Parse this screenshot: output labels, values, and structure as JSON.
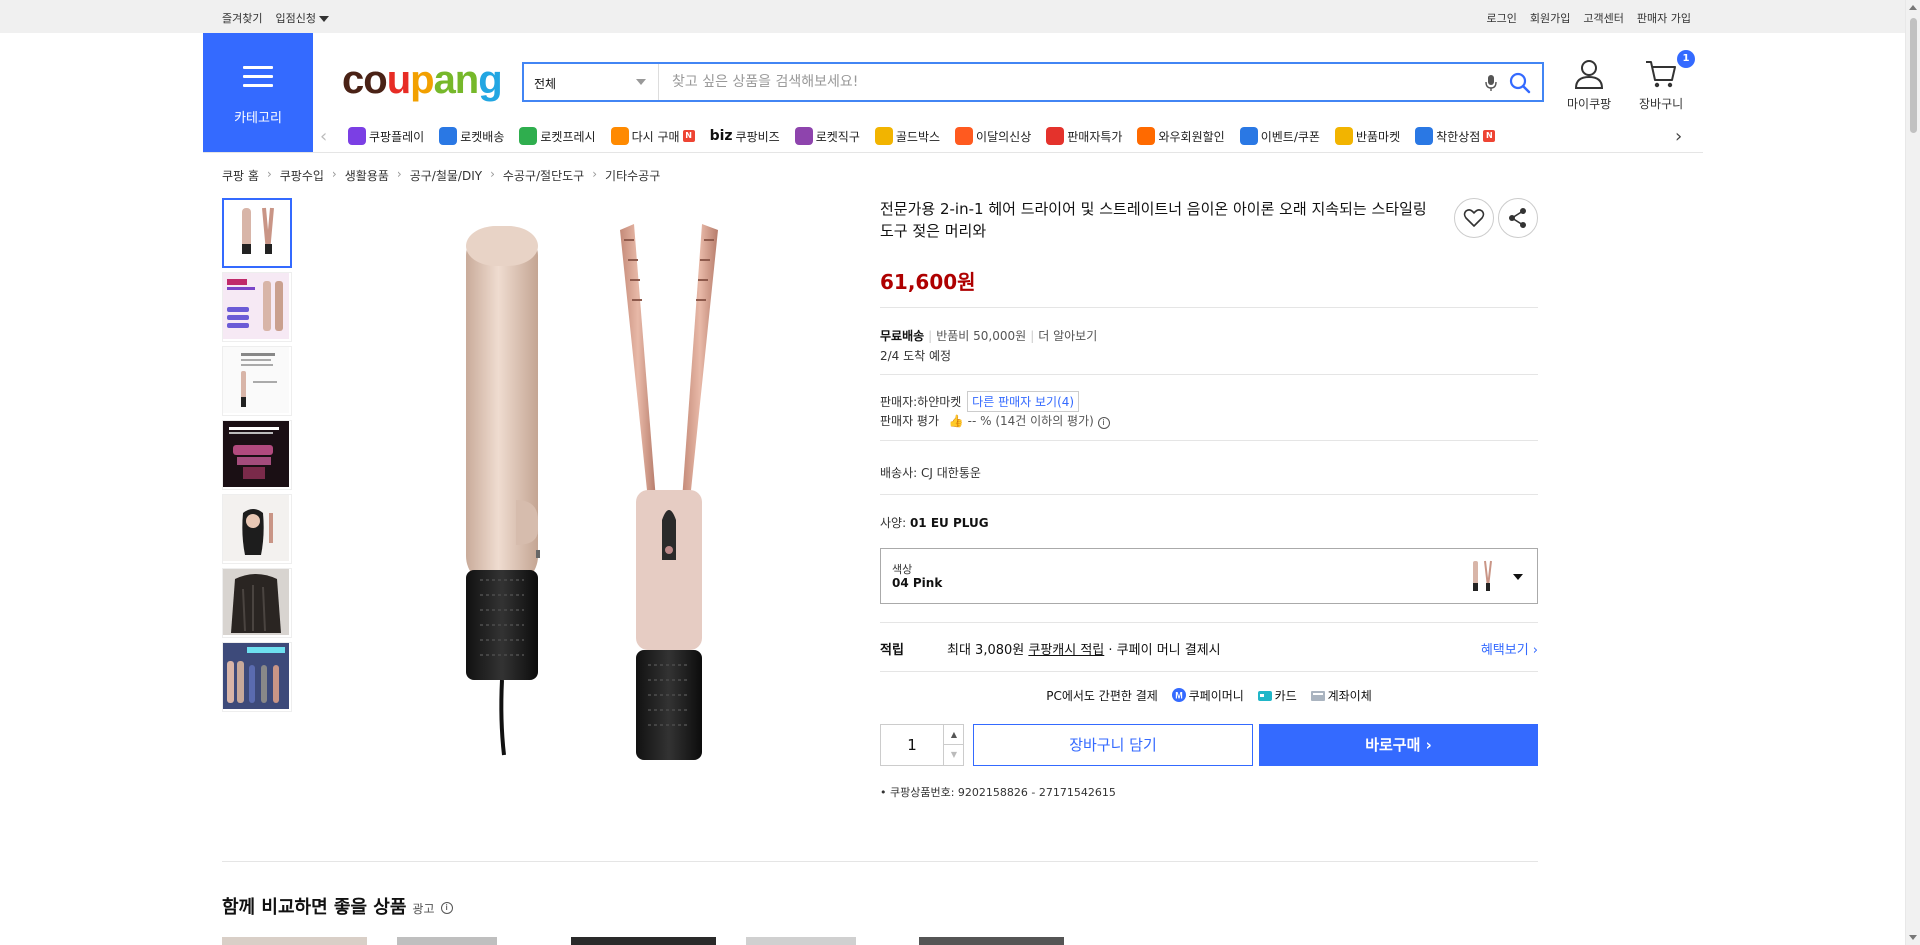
{
  "topbar": {
    "left": [
      "즐겨찾기",
      "입점신청"
    ],
    "right": [
      "로그인",
      "회원가입",
      "고객센터",
      "판매자 가입"
    ]
  },
  "header": {
    "category_label": "카테고리",
    "logo": [
      "co",
      "u",
      "p",
      "an",
      "g"
    ],
    "search": {
      "category": "전체",
      "placeholder": "찾고 싶은 상품을 검색해보세요!"
    },
    "my_label": "마이쿠팡",
    "cart_label": "장바구니",
    "cart_count": "1"
  },
  "catnav": [
    {
      "label": "쿠팡플레이",
      "color": "#7b3fe4"
    },
    {
      "label": "로켓배송",
      "color": "#2a78e4"
    },
    {
      "label": "로켓프레시",
      "color": "#2fae4e"
    },
    {
      "label": "다시 구매",
      "color": "#ff8a00",
      "tag": "N"
    },
    {
      "label": "쿠팡비즈",
      "prefix": "biz"
    },
    {
      "label": "로켓직구",
      "color": "#8e44ad"
    },
    {
      "label": "골드박스",
      "color": "#f2b400"
    },
    {
      "label": "이달의신상",
      "color": "#ff5a1f"
    },
    {
      "label": "판매자특가",
      "color": "#e4322c"
    },
    {
      "label": "와우회원할인",
      "color": "#ff6a00"
    },
    {
      "label": "이벤트/쿠폰",
      "color": "#2a78e4"
    },
    {
      "label": "반품마켓",
      "color": "#f2b400"
    },
    {
      "label": "착한상점",
      "color": "#2a78e4",
      "tag": "N"
    }
  ],
  "breadcrumb": [
    "쿠팡 홈",
    "쿠팡수입",
    "생활용품",
    "공구/철물/DIY",
    "수공구/절단도구",
    "기타수공구"
  ],
  "product": {
    "title": "전문가용 2-in-1 헤어 드라이어 및 스트레이트너 음이온 아이론 오래 지속되는 스타일링 도구 젖은 머리와",
    "price": "61,600원",
    "shipping": "무료배송",
    "return_fee": "반품비 50,000원",
    "more": "더 알아보기",
    "arrival": "2/4 도착 예정",
    "seller_label": "판매자:",
    "seller": "하얀마켓",
    "other_sellers": "다른 판매자 보기(4)",
    "seller_rating_label": "판매자 평가",
    "seller_rating": "-- % (14건 이하의 평가)",
    "carrier_label": "배송사:",
    "carrier": "CJ 대한통운",
    "spec_label": "사양:",
    "spec": "01 EU PLUG",
    "option_label": "색상",
    "option_value": "04 Pink",
    "reward_label": "적립",
    "reward_max": "최대 3,080원",
    "reward_cash": "쿠팡캐시 적립",
    "reward_tail": "· 쿠페이 머니 결제시",
    "reward_link": "혜택보기 ›",
    "pay_title": "PC에서도 간편한 결제",
    "pay_methods": [
      "쿠페이머니",
      "카드",
      "계좌이체"
    ],
    "quantity": "1",
    "cart_button": "장바구니 담기",
    "buy_button": "바로구매 ›",
    "product_id": "쿠팡상품번호: 9202158826 - 27171542615"
  },
  "section": {
    "compare_title": "함께 비교하면 좋을 상품",
    "ad_label": "광고"
  },
  "colors": {
    "accent": "#346aff",
    "price": "#ae0000"
  }
}
